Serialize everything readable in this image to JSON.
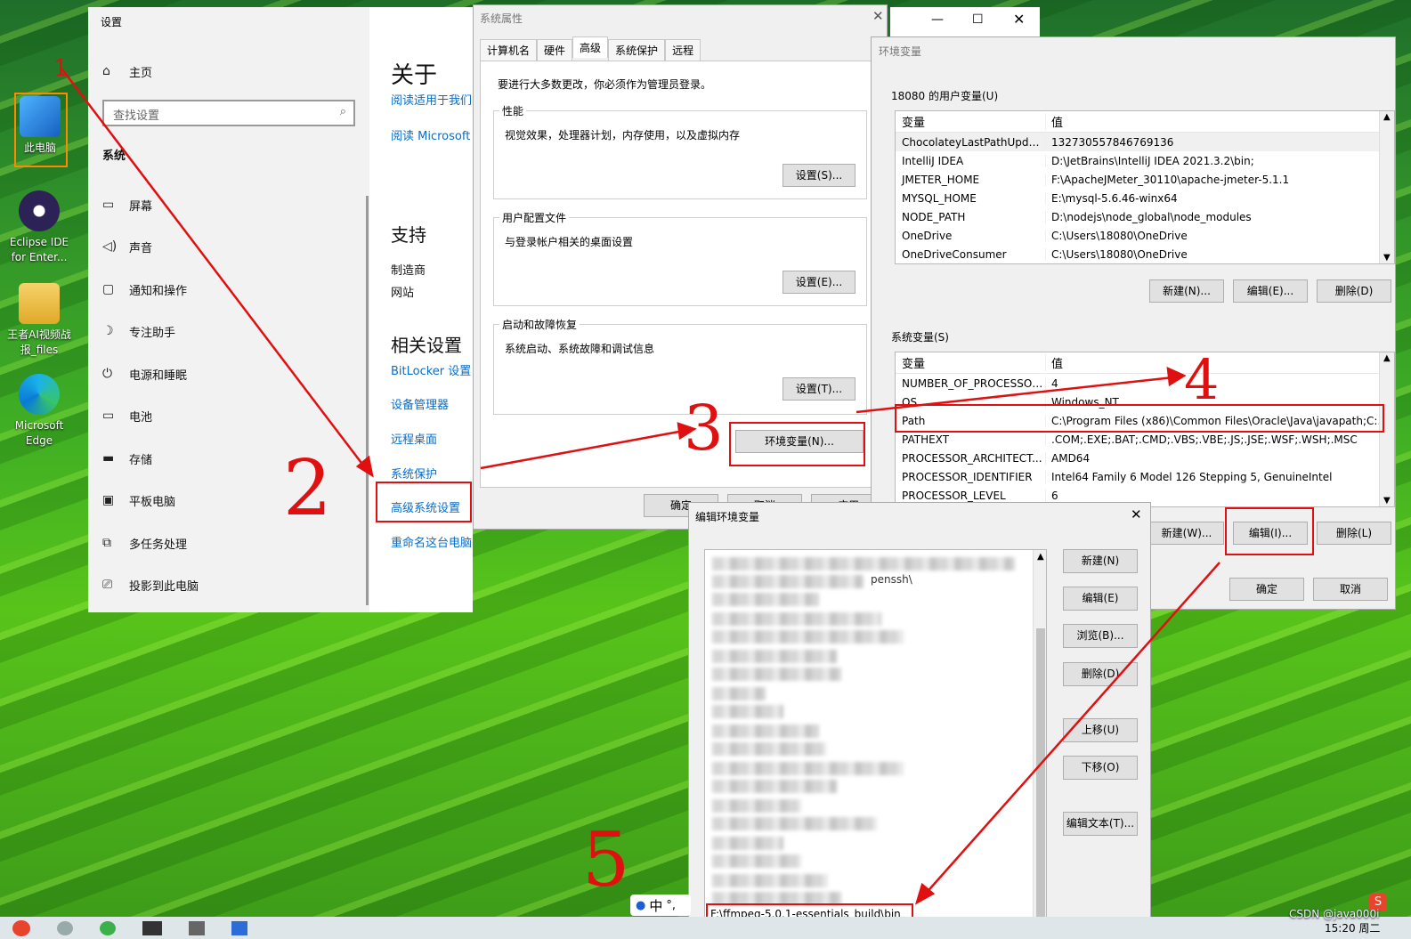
{
  "desktop": {
    "icons": [
      {
        "label": "此电脑"
      },
      {
        "label": "Eclipse IDE for Enter..."
      },
      {
        "label": "王者AI视频战报_files"
      },
      {
        "label": "Microsoft Edge"
      }
    ]
  },
  "settings": {
    "title": "设置",
    "home": "主页",
    "search_placeholder": "查找设置",
    "section": "系统",
    "nav": [
      "屏幕",
      "声音",
      "通知和操作",
      "专注助手",
      "电源和睡眠",
      "电池",
      "存储",
      "平板电脑",
      "多任务处理",
      "投影到此电脑"
    ],
    "about_title": "关于",
    "about_link1": "阅读适用于我们",
    "about_link2": "阅读 Microsoft",
    "support_title": "支持",
    "support_items": [
      "制造商",
      "网站"
    ],
    "related_title": "相关设置",
    "related_links": [
      "BitLocker 设置",
      "设备管理器",
      "远程桌面",
      "系统保护",
      "高级系统设置",
      "重命名这台电脑"
    ]
  },
  "sysprops": {
    "title": "系统属性",
    "tabs": [
      "计算机名",
      "硬件",
      "高级",
      "系统保护",
      "远程"
    ],
    "admin_note": "要进行大多数更改，你必须作为管理员登录。",
    "perf_title": "性能",
    "perf_desc": "视觉效果，处理器计划，内存使用，以及虚拟内存",
    "perf_btn": "设置(S)...",
    "profile_title": "用户配置文件",
    "profile_desc": "与登录帐户相关的桌面设置",
    "profile_btn": "设置(E)...",
    "startup_title": "启动和故障恢复",
    "startup_desc": "系统启动、系统故障和调试信息",
    "startup_btn": "设置(T)...",
    "env_btn": "环境变量(N)...",
    "ok_btn": "确定",
    "cancel_btn": "取消",
    "apply_btn": "应用"
  },
  "envvars": {
    "title": "环境变量",
    "user_label": "18080 的用户变量(U)",
    "col_var": "变量",
    "col_val": "值",
    "user_rows": [
      [
        "ChocolateyLastPathUpdate",
        "132730557846769136"
      ],
      [
        "IntelliJ IDEA",
        "D:\\JetBrains\\IntelliJ IDEA 2021.3.2\\bin;"
      ],
      [
        "JMETER_HOME",
        "F:\\ApacheJMeter_30110\\apache-jmeter-5.1.1"
      ],
      [
        "MYSQL_HOME",
        "E:\\mysql-5.6.46-winx64"
      ],
      [
        "NODE_PATH",
        "D:\\nodejs\\node_global\\node_modules"
      ],
      [
        "OneDrive",
        "C:\\Users\\18080\\OneDrive"
      ],
      [
        "OneDriveConsumer",
        "C:\\Users\\18080\\OneDrive"
      ]
    ],
    "user_new": "新建(N)...",
    "user_edit": "编辑(E)...",
    "user_delete": "删除(D)",
    "sys_label": "系统变量(S)",
    "sys_rows": [
      [
        "NUMBER_OF_PROCESSORS",
        "4"
      ],
      [
        "OS",
        "Windows_NT"
      ],
      [
        "Path",
        "C:\\Program Files (x86)\\Common Files\\Oracle\\Java\\javapath;C:..."
      ],
      [
        "PATHEXT",
        ".COM;.EXE;.BAT;.CMD;.VBS;.VBE;.JS;.JSE;.WSF;.WSH;.MSC"
      ],
      [
        "PROCESSOR_ARCHITECT...",
        "AMD64"
      ],
      [
        "PROCESSOR_IDENTIFIER",
        "Intel64 Family 6 Model 126 Stepping 5, GenuineIntel"
      ],
      [
        "PROCESSOR_LEVEL",
        "6"
      ]
    ],
    "sys_new": "新建(W)...",
    "sys_edit": "编辑(I)...",
    "sys_delete": "删除(L)",
    "ok_btn": "确定",
    "cancel_btn": "取消"
  },
  "editenv": {
    "title": "编辑环境变量",
    "partial_text": "penssh\\",
    "last_entry": "F:\\ffmpeg-5.0.1-essentials_build\\bin",
    "buttons": [
      "新建(N)",
      "编辑(E)",
      "浏览(B)...",
      "删除(D)",
      "上移(U)",
      "下移(O)",
      "编辑文本(T)..."
    ]
  },
  "ime": {
    "label": "中"
  },
  "taskbar": {
    "time": "15:20 周二",
    "watermark": "CSDN @java000i"
  },
  "annotations": [
    "1",
    "2",
    "3",
    "4",
    "5"
  ],
  "colors": {
    "annotation_red": "#e01010",
    "link_blue": "#0a6cc7"
  }
}
